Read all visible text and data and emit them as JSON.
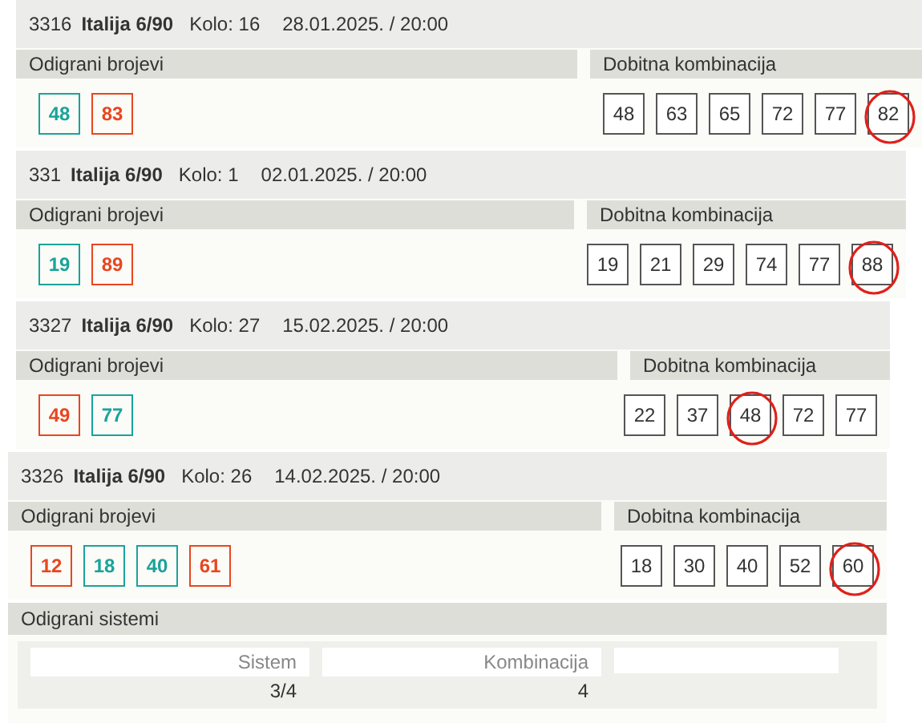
{
  "tickets": [
    {
      "id": "3316",
      "game": "Italija 6/90",
      "round": "Kolo: 16",
      "date": "28.01.2025. / 20:00",
      "played_label": "Odigrani brojevi",
      "winning_label": "Dobitna kombinacija",
      "played": [
        {
          "n": "48",
          "kind": "hit"
        },
        {
          "n": "83",
          "kind": "miss"
        }
      ],
      "winning": [
        {
          "n": "48",
          "circled": false
        },
        {
          "n": "63",
          "circled": false
        },
        {
          "n": "65",
          "circled": false
        },
        {
          "n": "72",
          "circled": false
        },
        {
          "n": "77",
          "circled": false
        },
        {
          "n": "82",
          "circled": true
        }
      ]
    },
    {
      "id": "331",
      "game": "Italija 6/90",
      "round": "Kolo: 1",
      "date": "02.01.2025. / 20:00",
      "played_label": "Odigrani brojevi",
      "winning_label": "Dobitna kombinacija",
      "played": [
        {
          "n": "19",
          "kind": "hit"
        },
        {
          "n": "89",
          "kind": "miss"
        }
      ],
      "winning": [
        {
          "n": "19",
          "circled": false
        },
        {
          "n": "21",
          "circled": false
        },
        {
          "n": "29",
          "circled": false
        },
        {
          "n": "74",
          "circled": false
        },
        {
          "n": "77",
          "circled": false
        },
        {
          "n": "88",
          "circled": true
        }
      ]
    },
    {
      "id": "3327",
      "game": "Italija 6/90",
      "round": "Kolo: 27",
      "date": "15.02.2025. / 20:00",
      "played_label": "Odigrani brojevi",
      "winning_label": "Dobitna kombinacija",
      "played": [
        {
          "n": "49",
          "kind": "miss"
        },
        {
          "n": "77",
          "kind": "hit"
        }
      ],
      "winning": [
        {
          "n": "22",
          "circled": false
        },
        {
          "n": "37",
          "circled": false
        },
        {
          "n": "48",
          "circled": true
        },
        {
          "n": "72",
          "circled": false
        },
        {
          "n": "77",
          "circled": false
        }
      ]
    },
    {
      "id": "3326",
      "game": "Italija 6/90",
      "round": "Kolo: 26",
      "date": "14.02.2025. / 20:00",
      "played_label": "Odigrani brojevi",
      "winning_label": "Dobitna kombinacija",
      "played": [
        {
          "n": "12",
          "kind": "miss"
        },
        {
          "n": "18",
          "kind": "hit"
        },
        {
          "n": "40",
          "kind": "hit"
        },
        {
          "n": "61",
          "kind": "miss"
        }
      ],
      "winning": [
        {
          "n": "18",
          "circled": false
        },
        {
          "n": "30",
          "circled": false
        },
        {
          "n": "40",
          "circled": false
        },
        {
          "n": "52",
          "circled": false
        },
        {
          "n": "60",
          "circled": true
        }
      ]
    }
  ],
  "systems": {
    "title": "Odigrani sistemi",
    "columns": [
      "Sistem",
      "Kombinacija"
    ],
    "row": [
      "3/4",
      "4"
    ]
  }
}
